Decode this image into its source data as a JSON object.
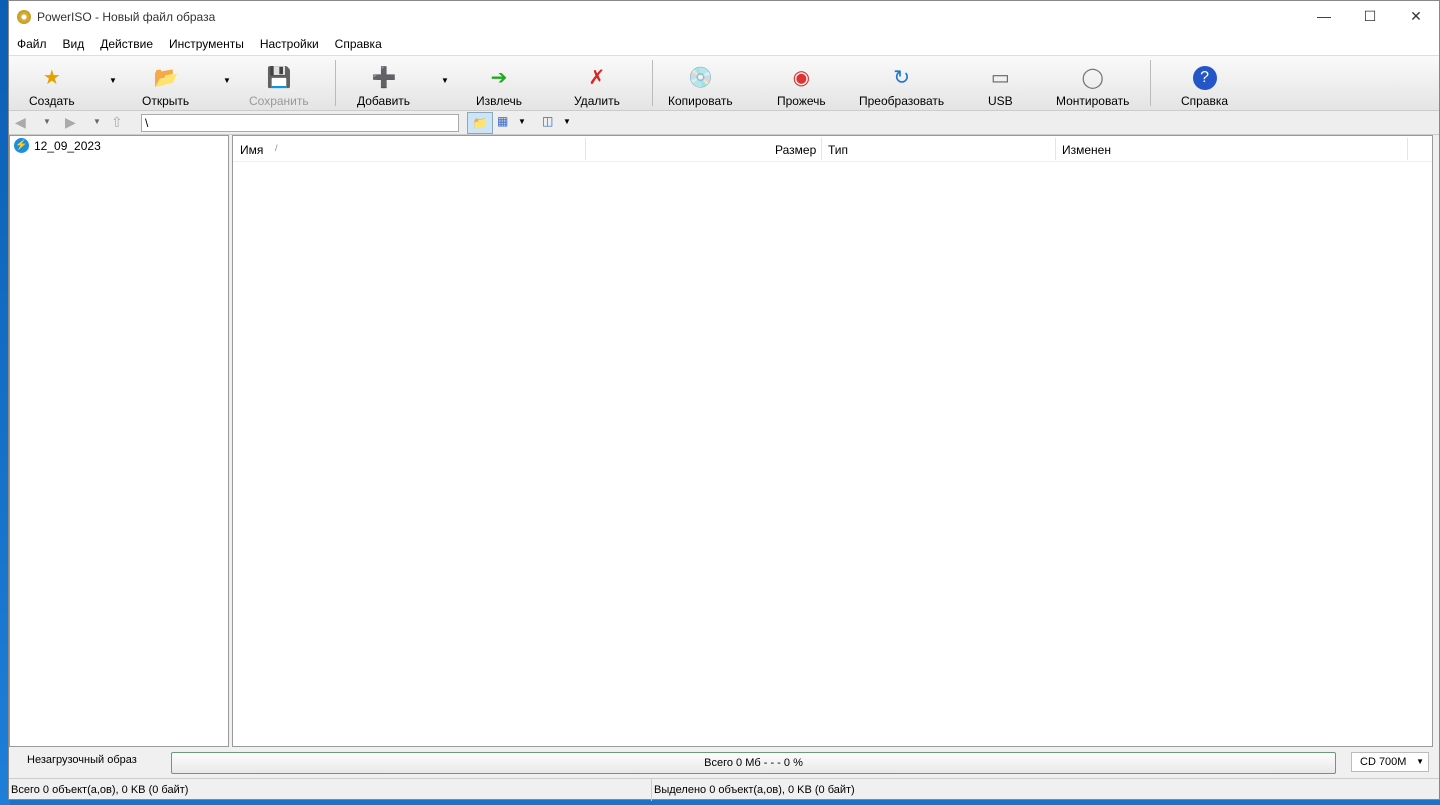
{
  "window": {
    "title": "PowerISO - Новый файл образа"
  },
  "menu": [
    "Файл",
    "Вид",
    "Действие",
    "Инструменты",
    "Настройки",
    "Справка"
  ],
  "toolbar": {
    "create": "Создать",
    "open": "Открыть",
    "save": "Сохранить",
    "add": "Добавить",
    "extract": "Извлечь",
    "delete": "Удалить",
    "copy": "Копировать",
    "burn": "Прожечь",
    "convert": "Преобразовать",
    "usb": "USB",
    "mount": "Монтировать",
    "help": "Справка"
  },
  "address": {
    "path": "\\"
  },
  "tree": {
    "root": "12_09_2023"
  },
  "columns": {
    "name": "Имя",
    "size": "Размер",
    "type": "Тип",
    "modified": "Изменен"
  },
  "status": {
    "boot": "Незагрузочный образ",
    "total": "Всего  0 Мб   - - -  0 %",
    "progress_percent": 0,
    "media": "CD 700M",
    "left": "Всего 0 объект(а,ов), 0 KB (0 байт)",
    "right": "Выделено 0 объект(а,ов), 0 KB (0 байт)"
  }
}
